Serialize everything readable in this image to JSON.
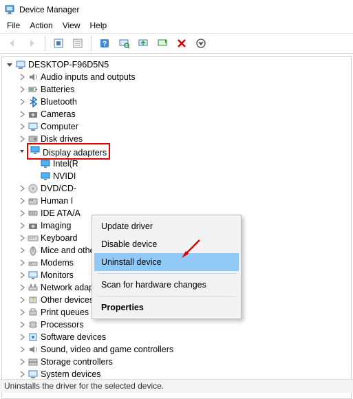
{
  "window": {
    "title": "Device Manager"
  },
  "menu": {
    "file": "File",
    "action": "Action",
    "view": "View",
    "help": "Help"
  },
  "toolbar": {
    "back": "back-icon",
    "forward": "forward-icon",
    "show_hidden": "show-hidden-icon",
    "properties": "properties-icon",
    "help": "help-icon",
    "scan": "scan-icon",
    "update": "update-driver-icon",
    "enable": "enable-device-icon",
    "uninstall_x": "uninstall-icon",
    "details": "details-icon"
  },
  "tree": {
    "root": "DESKTOP-F96D5N5",
    "categories": [
      {
        "id": "audio",
        "label": "Audio inputs and outputs"
      },
      {
        "id": "batteries",
        "label": "Batteries"
      },
      {
        "id": "bluetooth",
        "label": "Bluetooth"
      },
      {
        "id": "cameras",
        "label": "Cameras"
      },
      {
        "id": "computer",
        "label": "Computer"
      },
      {
        "id": "diskdrives",
        "label": "Disk drives"
      },
      {
        "id": "display",
        "label": "Display adapters"
      },
      {
        "id": "dvd",
        "label": "DVD/CD-"
      },
      {
        "id": "hid",
        "label": "Human I"
      },
      {
        "id": "ide",
        "label": "IDE ATA/A"
      },
      {
        "id": "imaging",
        "label": "Imaging "
      },
      {
        "id": "keyboard",
        "label": "Keyboard"
      },
      {
        "id": "mice",
        "label": "Mice and other pointing devices"
      },
      {
        "id": "modems",
        "label": "Modems"
      },
      {
        "id": "monitors",
        "label": "Monitors"
      },
      {
        "id": "network",
        "label": "Network adapters"
      },
      {
        "id": "other",
        "label": "Other devices"
      },
      {
        "id": "printq",
        "label": "Print queues"
      },
      {
        "id": "processors",
        "label": "Processors"
      },
      {
        "id": "software",
        "label": "Software devices"
      },
      {
        "id": "sound",
        "label": "Sound, video and game controllers"
      },
      {
        "id": "storage",
        "label": "Storage controllers"
      },
      {
        "id": "system",
        "label": "System devices"
      }
    ],
    "display_children": [
      {
        "id": "intel",
        "label": "Intel(R"
      },
      {
        "id": "nvidia",
        "label": "NVIDI"
      }
    ]
  },
  "context_menu": {
    "update": "Update driver",
    "disable": "Disable device",
    "uninstall": "Uninstall device",
    "scan": "Scan for hardware changes",
    "properties": "Properties"
  },
  "status": "Uninstalls the driver for the selected device."
}
